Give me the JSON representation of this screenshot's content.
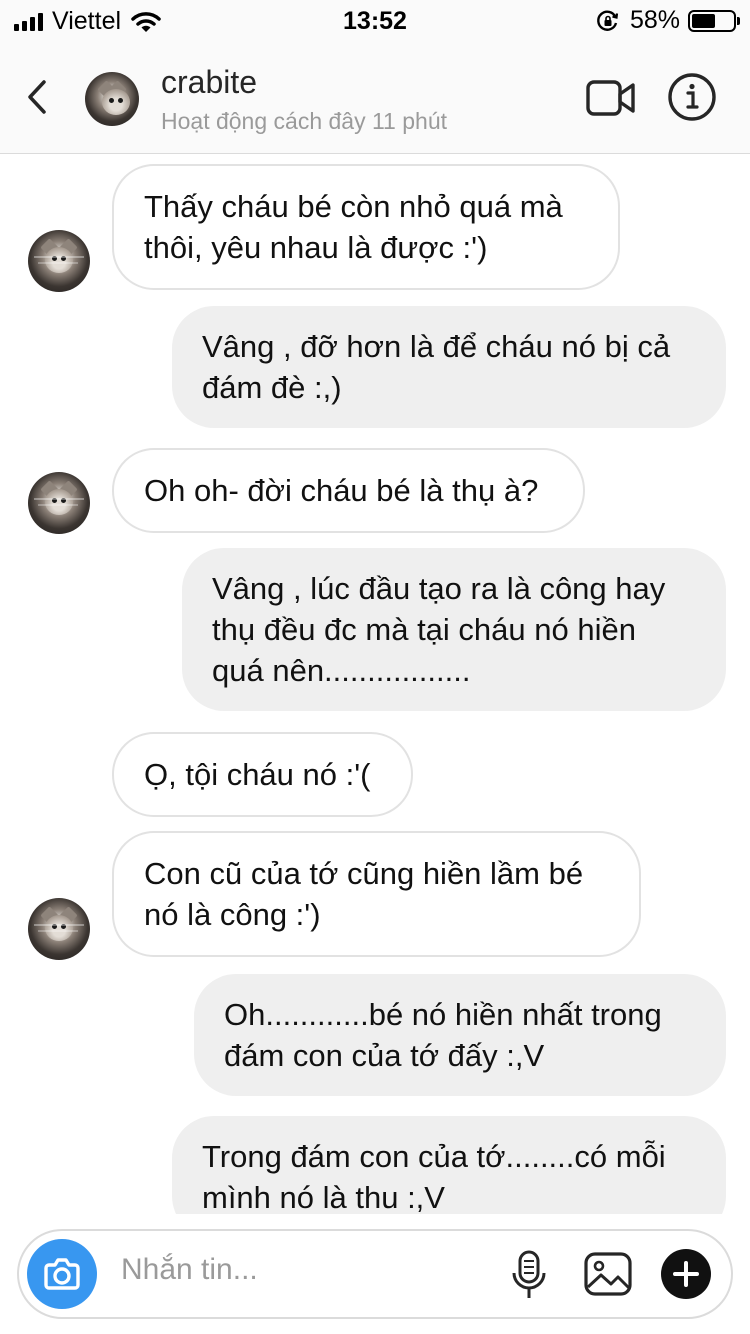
{
  "status_bar": {
    "carrier": "Viettel",
    "time": "13:52",
    "battery": "58%",
    "battery_level": 0.58
  },
  "header": {
    "username": "crabite",
    "activity": "Hoạt động cách đây 11 phút"
  },
  "messages": [
    {
      "side": "in",
      "text": "Thấy cháu bé còn nhỏ quá mà thôi, yêu nhau là được :')"
    },
    {
      "side": "out",
      "text": "Vâng , đỡ hơn là để cháu nó bị cả đám đè :,)"
    },
    {
      "side": "in",
      "text": "Oh oh- đời cháu bé là thụ à?"
    },
    {
      "side": "out",
      "text": "Vâng , lúc đầu tạo ra là công hay thụ đều đc mà tại cháu nó hiền quá nên................."
    },
    {
      "side": "in",
      "text": "Ọ, tội cháu nó :'("
    },
    {
      "side": "in",
      "text": "Con cũ của tớ cũng hiền lầm bé nó là công :')"
    },
    {
      "side": "out",
      "text": "Oh............bé nó hiền nhất trong đám con của tớ đấy :,V"
    },
    {
      "side": "out",
      "text": "Trong đám con của tớ........có mỗi mình nó là thu :,V"
    }
  ],
  "composer": {
    "placeholder": "Nhắn tin..."
  },
  "colors": {
    "accent": "#3897f0",
    "outgoing_bubble": "#efefef",
    "incoming_border": "#e2e2e2"
  }
}
